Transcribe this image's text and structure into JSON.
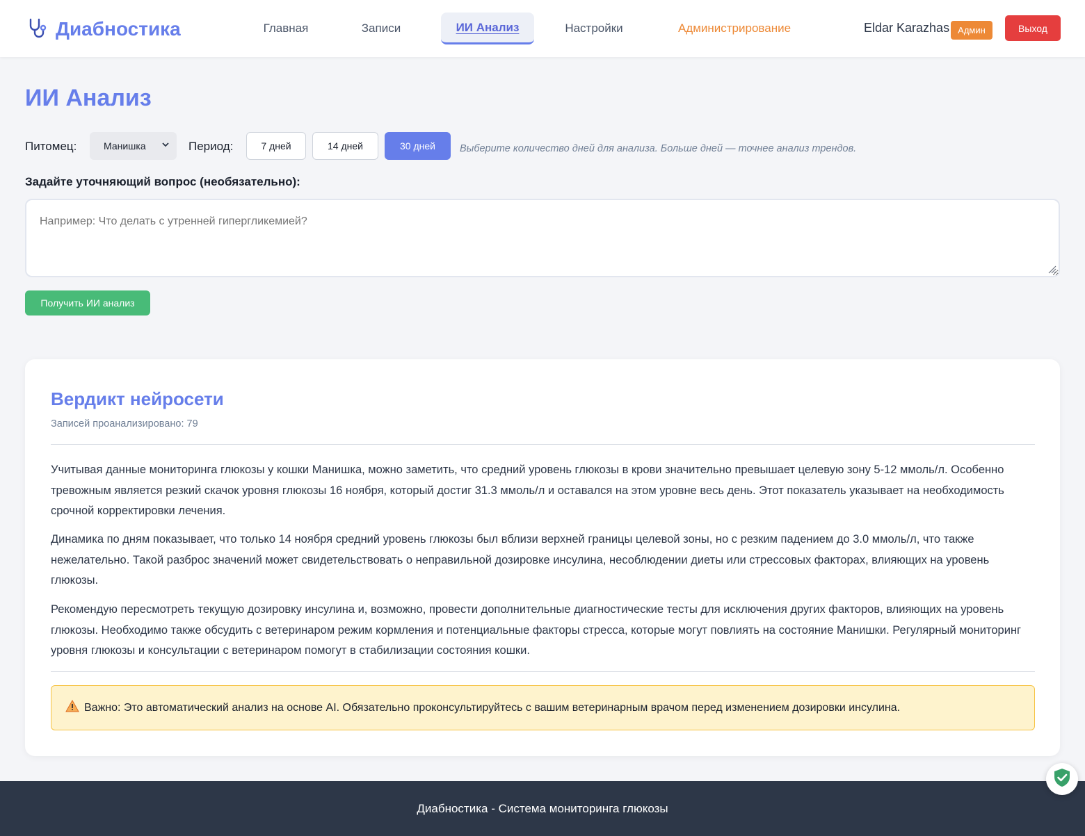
{
  "app": {
    "name": "Диабностика",
    "accent_color": "#667eea"
  },
  "nav": {
    "items": [
      {
        "label": "Главная"
      },
      {
        "label": "Записи"
      },
      {
        "label": "ИИ Анализ",
        "active": true
      },
      {
        "label": "Настройки"
      },
      {
        "label": "Администрирование"
      }
    ]
  },
  "user": {
    "name": "Eldar Karazhas",
    "role_badge": "Админ",
    "logout_label": "Выход"
  },
  "page": {
    "title": "ИИ Анализ"
  },
  "filters": {
    "pet_label": "Питомец:",
    "pet_selected": "Манишка",
    "period_label": "Период:",
    "periods": [
      {
        "label": "7 дней",
        "active": false
      },
      {
        "label": "14 дней",
        "active": false
      },
      {
        "label": "30 дней",
        "active": true
      }
    ],
    "hint": "Выберите количество дней для анализа. Больше дней — точнее анализ трендов."
  },
  "question": {
    "label": "Задайте уточняющий вопрос (необязательно):",
    "placeholder": "Например: Что делать с утренней гипергликемией?",
    "value": ""
  },
  "submit_label": "Получить ИИ анализ",
  "result": {
    "title": "Вердикт нейросети",
    "records_analyzed": "Записей проанализировано: 79",
    "paragraphs": [
      "Учитывая данные мониторинга глюкозы у кошки Манишка, можно заметить, что средний уровень глюкозы в крови значительно превышает целевую зону 5-12 ммоль/л. Особенно тревожным является резкий скачок уровня глюкозы 16 ноября, который достиг 31.3 ммоль/л и оставался на этом уровне весь день. Этот показатель указывает на необходимость срочной корректировки лечения.",
      "Динамика по дням показывает, что только 14 ноября средний уровень глюкозы был вблизи верхней границы целевой зоны, но с резким падением до 3.0 ммоль/л, что также нежелательно. Такой разброс значений может свидетельствовать о неправильной дозировке инсулина, несоблюдении диеты или стрессовых факторах, влияющих на уровень глюкозы.",
      "Рекомендую пересмотреть текущую дозировку инсулина и, возможно, провести дополнительные диагностические тесты для исключения других факторов, влияющих на уровень глюкозы. Необходимо также обсудить с ветеринаром режим кормления и потенциальные факторы стресса, которые могут повлиять на состояние Манишки. Регулярный мониторинг уровня глюкозы и консультации с ветеринаром помогут в стабилизации состояния кошки."
    ],
    "warning": "Важно: Это автоматический анализ на основе AI. Обязательно проконсультируйтесь с вашим ветеринарным врачом перед изменением дозировки инсулина."
  },
  "footer": {
    "text": "Диабностика - Система мониторинга глюкозы"
  },
  "icons": {
    "logo": "stethoscope-icon",
    "select": "chevron-down-icon",
    "warning": "warning-icon",
    "floating": "shield-check-icon"
  }
}
